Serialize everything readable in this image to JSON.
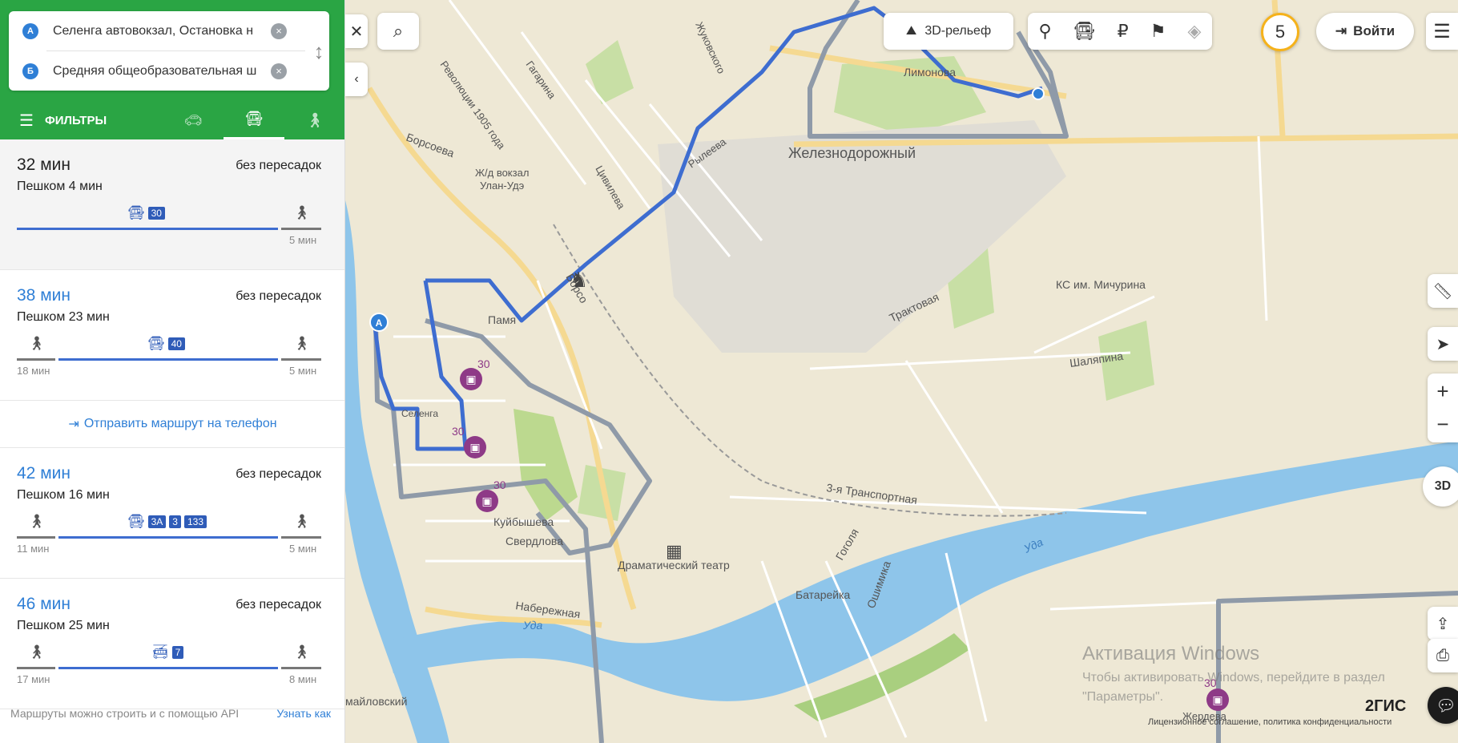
{
  "route_points": {
    "a": {
      "marker": "A",
      "value": "Селенга автовокзал, Остановка н"
    },
    "b": {
      "marker": "Б",
      "value": "Средняя общеобразовательная ш"
    }
  },
  "tabs": {
    "filters": "ФИЛЬТРЫ"
  },
  "routes": [
    {
      "time": "32 мин",
      "transfers": "без пересадок",
      "walk": "Пешком 4 мин",
      "numbers": [
        "30"
      ],
      "walk_end": "5 мин"
    },
    {
      "time": "38 мин",
      "transfers": "без пересадок",
      "walk": "Пешком 23 мин",
      "numbers": [
        "40"
      ],
      "walk_start": "18 мин",
      "walk_end": "5 мин"
    },
    {
      "time": "42 мин",
      "transfers": "без пересадок",
      "walk": "Пешком 16 мин",
      "numbers": [
        "3А",
        "3",
        "133"
      ],
      "walk_start": "11 мин",
      "walk_end": "5 мин"
    },
    {
      "time": "46 мин",
      "transfers": "без пересадок",
      "walk": "Пешком 25 мин",
      "numbers": [
        "7"
      ],
      "walk_start": "17 мин",
      "walk_end": "8 мин"
    }
  ],
  "send_to_phone": "Отправить маршрут на телефон",
  "footer": {
    "text": "Маршруты можно строить и с помощью API",
    "link": "Узнать как"
  },
  "map": {
    "relief_button": "3D-рельеф",
    "notifications": "5",
    "login": "Войти",
    "view_3d": "3D",
    "logo": "2ГИС",
    "legal": "Лицензионное соглашение, политика конфиденциальности",
    "watermark_title": "Активация Windows",
    "watermark_text": "Чтобы активировать Windows, перейдите в раздел \"Параметры\".",
    "labels": {
      "zheleznodorozhny": "Железнодорожный",
      "limonova": "Лимонова",
      "vokzal1": "Ж/д вокзал",
      "vokzal2": "Улан-Удэ",
      "borsoeva": "Борсоева",
      "borsoeva2": "Борсо",
      "revolution": "Революции 1905 года",
      "gagarina": "Гагарина",
      "tsivileva": "Цивилева",
      "ryleeva": "Рылеева",
      "zhukovskogo": "Жуковского",
      "traktovaya": "Трактовая",
      "shalyapina": "Шаляпина",
      "michurina": "КС им. Мичурина",
      "transport3": "3-я Транспортная",
      "teatr": "Драматический театр",
      "kuibysheva": "Куйбышева",
      "sverdlova": "Свердлова",
      "naberezhnaya": "Набережная",
      "uda1": "Уда",
      "uda2": "Уда",
      "batareika": "Батарейка",
      "gogolya": "Гоголя",
      "oshimika": "Ошимика",
      "maiskiy": "майловский",
      "selenga": "Селенга",
      "pamyat": "Памя",
      "zherdeva": "Жердева",
      "bus30": "30"
    }
  },
  "colors": {
    "green": "#2aa544",
    "route": "#3e6dd0",
    "accent": "#2f7fd6",
    "badge": "#f5b21b",
    "stop": "#8e3a87"
  }
}
